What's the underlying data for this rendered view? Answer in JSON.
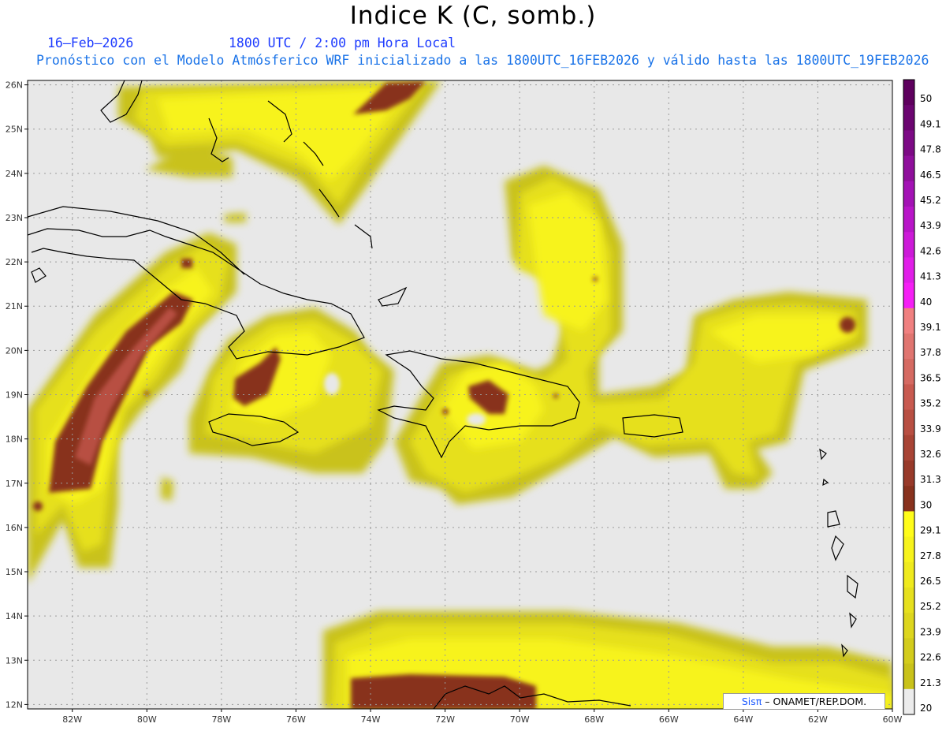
{
  "header": {
    "title": "Indice K (C, somb.)",
    "date": "16–Feb–2026",
    "time": "1800 UTC / 2:00 pm Hora Local",
    "forecast": "Pronóstico con el Modelo Atmósferico WRF inicializado a las 1800UTC_16FEB2026 y válido hasta las  1800UTC_19FEB2026"
  },
  "map": {
    "lon_labels": [
      "82W",
      "80W",
      "78W",
      "76W",
      "74W",
      "72W",
      "70W",
      "68W",
      "66W",
      "64W",
      "62W",
      "60W"
    ],
    "lat_labels": [
      "26N",
      "25N",
      "24N",
      "23N",
      "22N",
      "21N",
      "20N",
      "19N",
      "18N",
      "17N",
      "16N",
      "15N",
      "14N",
      "13N",
      "12N"
    ],
    "lon_range": [
      -83.2,
      -60.0
    ],
    "lat_range": [
      11.9,
      26.1
    ],
    "gridlines": "dotted",
    "ocean_color": "#e8e8e8",
    "coastline_color": "#000000"
  },
  "colorbar": {
    "labels": [
      "50",
      "49.1",
      "47.8",
      "46.5",
      "45.2",
      "43.9",
      "42.6",
      "41.3",
      "40",
      "39.1",
      "37.8",
      "36.5",
      "35.2",
      "33.9",
      "32.6",
      "31.3",
      "30",
      "29.1",
      "27.8",
      "26.5",
      "25.2",
      "23.9",
      "22.6",
      "21.3",
      "20"
    ],
    "colors": [
      "#5e005e",
      "#6b0570",
      "#7c0a85",
      "#8f0f9c",
      "#a312b5",
      "#b815c8",
      "#cc1ad8",
      "#e01ee8",
      "#f51ff5",
      "#f08080",
      "#e07570",
      "#d56a62",
      "#c85a50",
      "#b84f42",
      "#a84435",
      "#983a2a",
      "#88321e",
      "#fffc1a",
      "#f7f31c",
      "#efea1d",
      "#e6e01e",
      "#ddd61e",
      "#d3cc1c",
      "#c9c21a",
      "#bfb818"
    ]
  },
  "credit": {
    "brand": "Sisπ",
    "text": "– ONAMET/REP.DOM."
  }
}
